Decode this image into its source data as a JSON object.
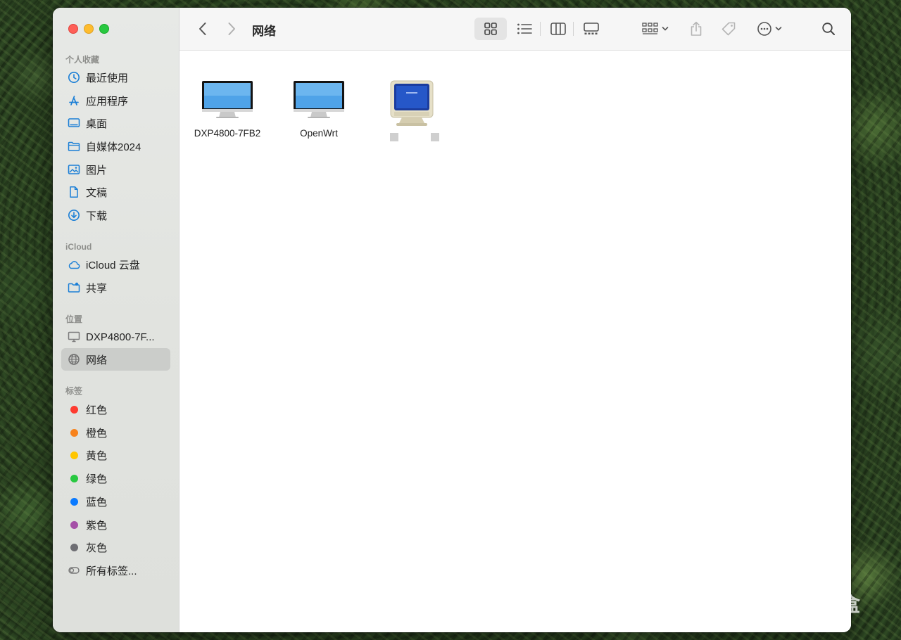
{
  "window": {
    "title": "网络"
  },
  "sidebar": {
    "favorites": {
      "title": "个人收藏",
      "items": [
        {
          "label": "最近使用",
          "icon": "clock-icon"
        },
        {
          "label": "应用程序",
          "icon": "applications-icon"
        },
        {
          "label": "桌面",
          "icon": "desktop-icon"
        },
        {
          "label": "自媒体2024",
          "icon": "folder-icon"
        },
        {
          "label": "图片",
          "icon": "photo-icon"
        },
        {
          "label": "文稿",
          "icon": "document-icon"
        },
        {
          "label": "下载",
          "icon": "download-icon"
        }
      ]
    },
    "icloud": {
      "title": "iCloud",
      "items": [
        {
          "label": "iCloud 云盘",
          "icon": "cloud-icon"
        },
        {
          "label": "共享",
          "icon": "shared-folder-icon"
        }
      ]
    },
    "locations": {
      "title": "位置",
      "items": [
        {
          "label": "DXP4800-7F...",
          "icon": "monitor-icon"
        },
        {
          "label": "网络",
          "icon": "globe-icon",
          "selected": true
        }
      ]
    },
    "tags": {
      "title": "标签",
      "items": [
        {
          "label": "红色",
          "color": "#fe3b30"
        },
        {
          "label": "橙色",
          "color": "#f7821b"
        },
        {
          "label": "黄色",
          "color": "#ffc600"
        },
        {
          "label": "绿色",
          "color": "#28c840"
        },
        {
          "label": "蓝色",
          "color": "#0a7aff"
        },
        {
          "label": "紫色",
          "color": "#a550a7"
        },
        {
          "label": "灰色",
          "color": "#8e8e93"
        },
        {
          "label": "所有标签...",
          "icon": "all-tags-icon"
        }
      ]
    }
  },
  "files": [
    {
      "name": "DXP4800-7FB2",
      "icon": "imac-icon"
    },
    {
      "name": "OpenWrt",
      "icon": "imac-icon"
    },
    {
      "name": "",
      "icon": "crt-monitor-icon",
      "redacted": true
    }
  ],
  "watermark": {
    "text": "小黑盒"
  },
  "colors": {
    "accent": "#0a7aff",
    "sidebar_icon": "#1b7fd6"
  }
}
